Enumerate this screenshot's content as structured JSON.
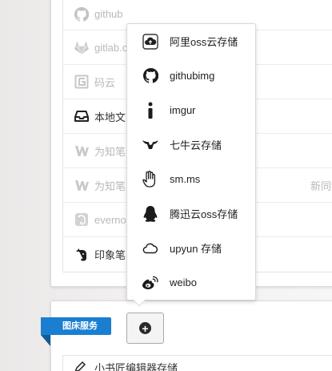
{
  "list": {
    "rows": [
      {
        "label": "github",
        "icon": "github-icon",
        "state": "disabled"
      },
      {
        "label": "gitlab.com",
        "icon": "gitlab-icon",
        "state": "disabled"
      },
      {
        "label": "码云",
        "icon": "gitee-icon",
        "state": "disabled"
      },
      {
        "label": "本地文",
        "icon": "inbox-icon",
        "state": "active"
      },
      {
        "label": "为知笔",
        "icon": "wiz-icon",
        "state": "disabled"
      },
      {
        "label": "为知笔",
        "icon": "wiz-icon",
        "state": "disabled",
        "tail": "新同步方式的用"
      },
      {
        "label": "evernote",
        "icon": "evernote-icon",
        "state": "disabled"
      },
      {
        "label": "印象笔",
        "icon": "evernote-icon",
        "state": "active"
      }
    ]
  },
  "dropdown": {
    "items": [
      {
        "label": "阿里oss云存储",
        "icon": "cloud-upload-icon"
      },
      {
        "label": "githubimg",
        "icon": "github-icon"
      },
      {
        "label": "imgur",
        "icon": "info-icon"
      },
      {
        "label": "七牛云存储",
        "icon": "qiniu-bull-icon"
      },
      {
        "label": "sm.ms",
        "icon": "hand-pointer-icon"
      },
      {
        "label": "腾迅云oss存储",
        "icon": "qq-penguin-icon"
      },
      {
        "label": "upyun 存储",
        "icon": "cloud-outline-icon"
      },
      {
        "label": "weibo",
        "icon": "weibo-icon"
      }
    ]
  },
  "section": {
    "ribbon_label": "图床服务",
    "add_button": "+",
    "bottom_row_label": "小书匠编辑器存储"
  },
  "colors": {
    "ribbon": "#1a7fd0",
    "disabled_text": "#b9b9b9"
  }
}
